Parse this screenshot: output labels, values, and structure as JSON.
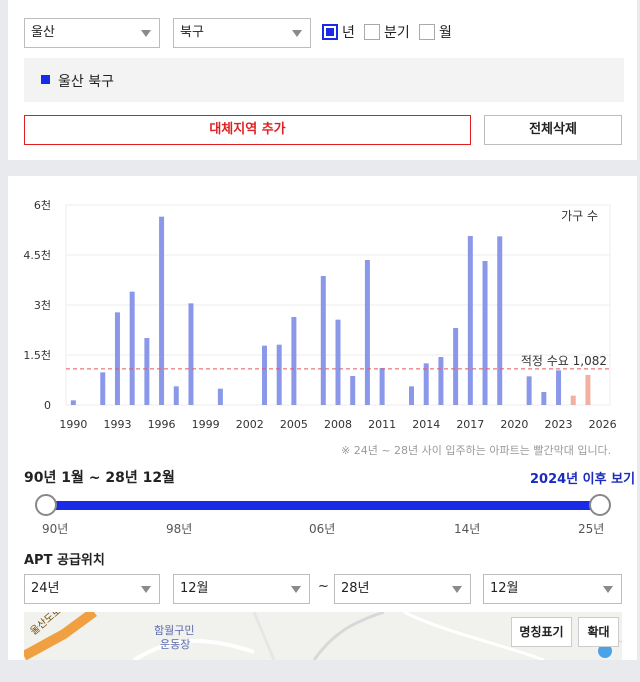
{
  "filters": {
    "region_select": "울산",
    "district_select": "북구",
    "period": [
      {
        "label": "년",
        "checked": true
      },
      {
        "label": "분기",
        "checked": false
      },
      {
        "label": "월",
        "checked": false
      }
    ]
  },
  "selected_region": "울산 북구",
  "buttons": {
    "add_region": "대체지역 추가",
    "delete_all": "전체삭제"
  },
  "colors": {
    "accent": "#1a2be8",
    "bar_past": "#8b98ea",
    "bar_future": "#f2b0a1",
    "demand_line": "#e05a5a",
    "danger": "#e02020"
  },
  "chart_data": {
    "type": "bar",
    "legend": "가구 수",
    "y_ticks": [
      "6천",
      "4.5천",
      "3천",
      "1.5천",
      "0"
    ],
    "y_tick_values": [
      6000,
      4500,
      3000,
      1500,
      0
    ],
    "ylim": [
      0,
      6000
    ],
    "x_ticks": [
      "1990",
      "1993",
      "1996",
      "1999",
      "2002",
      "2005",
      "2008",
      "2011",
      "2014",
      "2017",
      "2020",
      "2023",
      "2026"
    ],
    "xlim": [
      1989.5,
      2026.5
    ],
    "demand_label": "적정 수요 1,082",
    "demand_value": 1082,
    "bars": [
      {
        "year": 1990,
        "value": 140,
        "future": false
      },
      {
        "year": 1992,
        "value": 980,
        "future": false
      },
      {
        "year": 1993,
        "value": 2780,
        "future": false
      },
      {
        "year": 1994,
        "value": 3400,
        "future": false
      },
      {
        "year": 1995,
        "value": 2010,
        "future": false
      },
      {
        "year": 1996,
        "value": 5650,
        "future": false
      },
      {
        "year": 1997,
        "value": 560,
        "future": false
      },
      {
        "year": 1998,
        "value": 3050,
        "future": false
      },
      {
        "year": 2000,
        "value": 490,
        "future": false
      },
      {
        "year": 2003,
        "value": 1780,
        "future": false
      },
      {
        "year": 2004,
        "value": 1810,
        "future": false
      },
      {
        "year": 2005,
        "value": 2640,
        "future": false
      },
      {
        "year": 2007,
        "value": 3870,
        "future": false
      },
      {
        "year": 2008,
        "value": 2560,
        "future": false
      },
      {
        "year": 2009,
        "value": 870,
        "future": false
      },
      {
        "year": 2010,
        "value": 4350,
        "future": false
      },
      {
        "year": 2011,
        "value": 1110,
        "future": false
      },
      {
        "year": 2013,
        "value": 560,
        "future": false
      },
      {
        "year": 2014,
        "value": 1250,
        "future": false
      },
      {
        "year": 2015,
        "value": 1440,
        "future": false
      },
      {
        "year": 2016,
        "value": 2310,
        "future": false
      },
      {
        "year": 2017,
        "value": 5070,
        "future": false
      },
      {
        "year": 2018,
        "value": 4320,
        "future": false
      },
      {
        "year": 2019,
        "value": 5060,
        "future": false
      },
      {
        "year": 2021,
        "value": 860,
        "future": false
      },
      {
        "year": 2022,
        "value": 390,
        "future": false
      },
      {
        "year": 2023,
        "value": 1040,
        "future": false
      },
      {
        "year": 2024,
        "value": 280,
        "future": true
      },
      {
        "year": 2025,
        "value": 900,
        "future": true
      }
    ]
  },
  "chart_note": "※ 24년 ~ 28년 사이 입주하는 아파트는 빨간막대 입니다.",
  "range": {
    "title": "90년 1월 ~ 28년 12월",
    "after_link": "2024년 이후 보기",
    "ticks": [
      "90년",
      "98년",
      "06년",
      "14년",
      "25년"
    ],
    "start_fraction": 0,
    "end_fraction": 1
  },
  "apt": {
    "title": "APT 공급위치",
    "from_year": "24년",
    "from_month": "12월",
    "separator": "~",
    "to_year": "28년",
    "to_month": "12월"
  },
  "map": {
    "label_road": "울산도로 (울산 - 포",
    "label_poi_line1": "함월구민",
    "label_poi_line2": "운동장",
    "btn_name": "명칭표기",
    "btn_zoom": "확대"
  }
}
